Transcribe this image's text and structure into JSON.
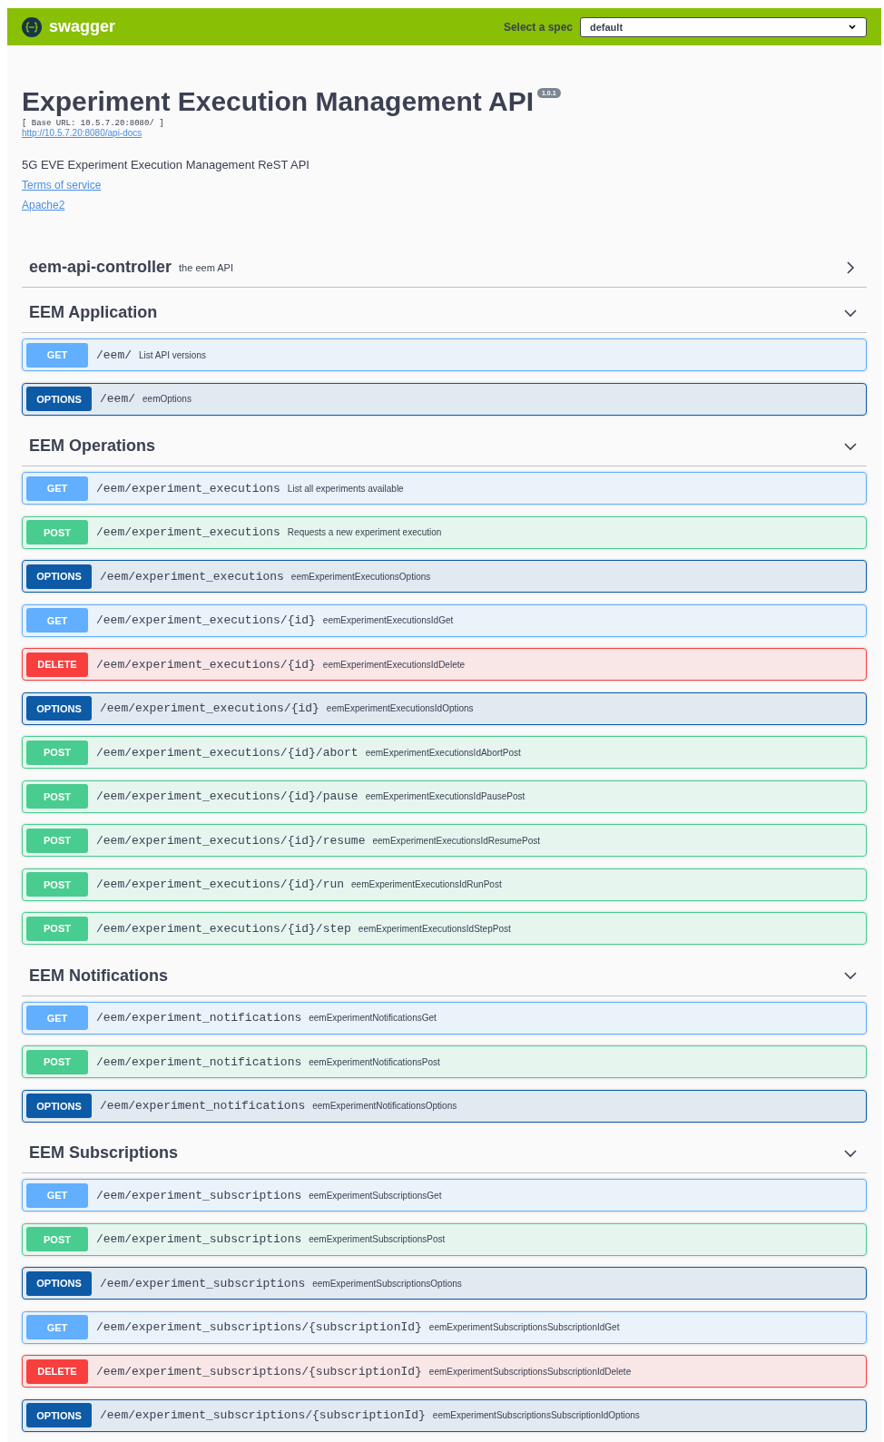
{
  "topbar": {
    "brand": "swagger",
    "spec_label": "Select a spec",
    "spec_value": "default"
  },
  "info": {
    "title": "Experiment Execution Management API",
    "version": "1.0.1",
    "base_url": "[ Base URL: 10.5.7.20:8080/ ]",
    "docs_link": "http://10.5.7.20:8080/api-docs",
    "description": "5G EVE Experiment Execution Management ReST API",
    "terms_link": "Terms of service",
    "license_link": "Apache2"
  },
  "tags": [
    {
      "name": "eem-api-controller",
      "description": "the eem API",
      "expanded": false
    },
    {
      "name": "EEM Application",
      "expanded": true,
      "operations": [
        {
          "method": "GET",
          "path": "/eem/",
          "summary": "List API versions"
        },
        {
          "method": "OPTIONS",
          "path": "/eem/",
          "summary": "eemOptions"
        }
      ]
    },
    {
      "name": "EEM Operations",
      "expanded": true,
      "operations": [
        {
          "method": "GET",
          "path": "/eem/experiment_executions",
          "summary": "List all experiments available"
        },
        {
          "method": "POST",
          "path": "/eem/experiment_executions",
          "summary": "Requests a new experiment execution"
        },
        {
          "method": "OPTIONS",
          "path": "/eem/experiment_executions",
          "summary": "eemExperimentExecutionsOptions"
        },
        {
          "method": "GET",
          "path": "/eem/experiment_executions/{id}",
          "summary": "eemExperimentExecutionsIdGet"
        },
        {
          "method": "DELETE",
          "path": "/eem/experiment_executions/{id}",
          "summary": "eemExperimentExecutionsIdDelete"
        },
        {
          "method": "OPTIONS",
          "path": "/eem/experiment_executions/{id}",
          "summary": "eemExperimentExecutionsIdOptions"
        },
        {
          "method": "POST",
          "path": "/eem/experiment_executions/{id}/abort",
          "summary": "eemExperimentExecutionsIdAbortPost"
        },
        {
          "method": "POST",
          "path": "/eem/experiment_executions/{id}/pause",
          "summary": "eemExperimentExecutionsIdPausePost"
        },
        {
          "method": "POST",
          "path": "/eem/experiment_executions/{id}/resume",
          "summary": "eemExperimentExecutionsIdResumePost"
        },
        {
          "method": "POST",
          "path": "/eem/experiment_executions/{id}/run",
          "summary": "eemExperimentExecutionsIdRunPost"
        },
        {
          "method": "POST",
          "path": "/eem/experiment_executions/{id}/step",
          "summary": "eemExperimentExecutionsIdStepPost"
        }
      ]
    },
    {
      "name": "EEM Notifications",
      "expanded": true,
      "operations": [
        {
          "method": "GET",
          "path": "/eem/experiment_notifications",
          "summary": "eemExperimentNotificationsGet"
        },
        {
          "method": "POST",
          "path": "/eem/experiment_notifications",
          "summary": "eemExperimentNotificationsPost"
        },
        {
          "method": "OPTIONS",
          "path": "/eem/experiment_notifications",
          "summary": "eemExperimentNotificationsOptions"
        }
      ]
    },
    {
      "name": "EEM Subscriptions",
      "expanded": true,
      "operations": [
        {
          "method": "GET",
          "path": "/eem/experiment_subscriptions",
          "summary": "eemExperimentSubscriptionsGet"
        },
        {
          "method": "POST",
          "path": "/eem/experiment_subscriptions",
          "summary": "eemExperimentSubscriptionsPost"
        },
        {
          "method": "OPTIONS",
          "path": "/eem/experiment_subscriptions",
          "summary": "eemExperimentSubscriptionsOptions"
        },
        {
          "method": "GET",
          "path": "/eem/experiment_subscriptions/{subscriptionId}",
          "summary": "eemExperimentSubscriptionsSubscriptionIdGet"
        },
        {
          "method": "DELETE",
          "path": "/eem/experiment_subscriptions/{subscriptionId}",
          "summary": "eemExperimentSubscriptionsSubscriptionIdDelete"
        },
        {
          "method": "OPTIONS",
          "path": "/eem/experiment_subscriptions/{subscriptionId}",
          "summary": "eemExperimentSubscriptionsSubscriptionIdOptions"
        }
      ]
    }
  ]
}
